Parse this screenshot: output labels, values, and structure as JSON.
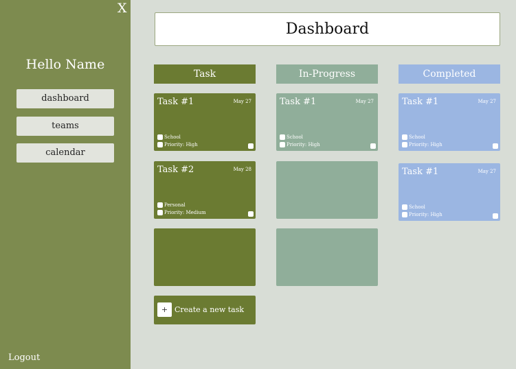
{
  "sidebar": {
    "close_label": "X",
    "greeting": "Hello Name",
    "nav": [
      {
        "label": "dashboard"
      },
      {
        "label": "teams"
      },
      {
        "label": "calendar"
      }
    ],
    "logout_label": "Logout"
  },
  "header": {
    "title": "Dashboard"
  },
  "columns": [
    {
      "title": "Task"
    },
    {
      "title": "In-Progress"
    },
    {
      "title": "Completed"
    }
  ],
  "cards": {
    "task": [
      {
        "title": "Task #1",
        "date": "May 27",
        "category": "School",
        "priority": "Priority: High"
      },
      {
        "title": "Task #2",
        "date": "May 28",
        "category": "Personal",
        "priority": "Priority: Medium"
      }
    ],
    "progress": [
      {
        "title": "Task #1",
        "date": "May 27",
        "category": "School",
        "priority": "Priority: High"
      }
    ],
    "completed": [
      {
        "title": "Task #1",
        "date": "May 27",
        "category": "School",
        "priority": "Priority: High"
      },
      {
        "title": "Task #1",
        "date": "May 27",
        "category": "School",
        "priority": "Priority: High"
      }
    ]
  },
  "create_task": {
    "icon": "+",
    "label": "Create a new task"
  },
  "colors": {
    "sidebar": "#7d8b4f",
    "background": "#d8ddd6",
    "task": "#6b7b32",
    "in_progress": "#90ae9a",
    "completed": "#9bb6e2"
  }
}
